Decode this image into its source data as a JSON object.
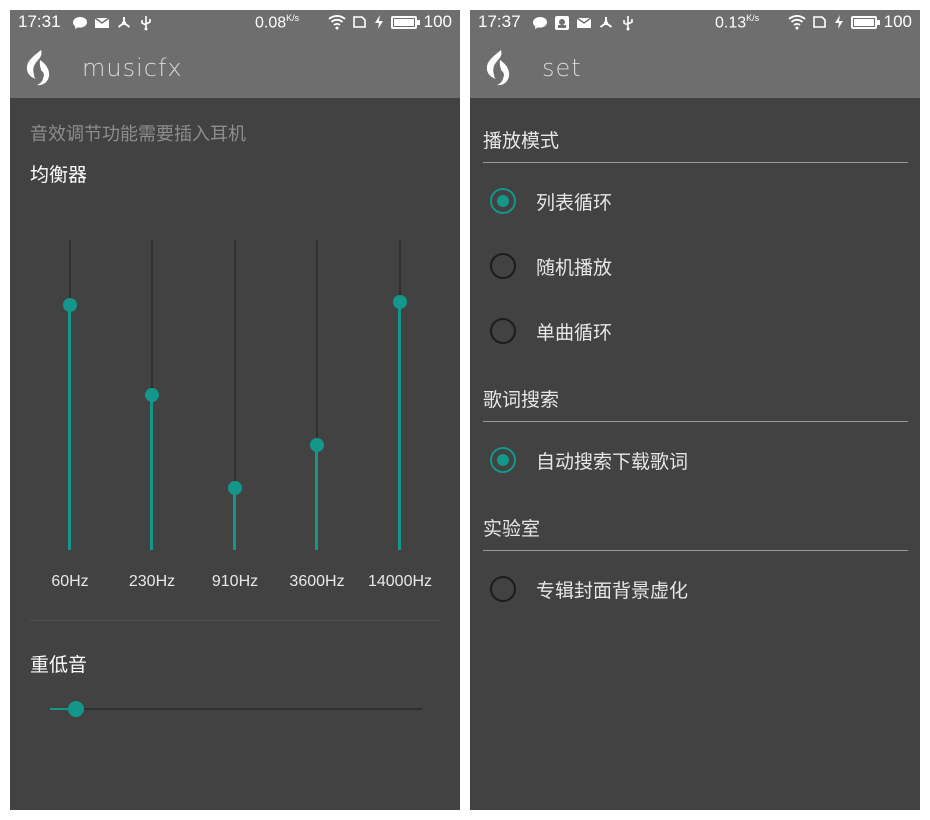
{
  "left": {
    "status": {
      "time": "17:31",
      "speed": "0.08",
      "speed_unit": "K/s",
      "battery": "100"
    },
    "app_title": "musicfx",
    "hint": "音效调节功能需要插入耳机",
    "equalizer_title": "均衡器",
    "bands": [
      {
        "label": "60Hz",
        "level": 0.79
      },
      {
        "label": "230Hz",
        "level": 0.5
      },
      {
        "label": "910Hz",
        "level": 0.2
      },
      {
        "label": "3600Hz",
        "level": 0.34
      },
      {
        "label": "14000Hz",
        "level": 0.8
      }
    ],
    "bass_title": "重低音",
    "bass_level": 0.07
  },
  "right": {
    "status": {
      "time": "17:37",
      "speed": "0.13",
      "speed_unit": "K/s",
      "battery": "100"
    },
    "app_title": "set",
    "play_mode_title": "播放模式",
    "play_modes": [
      {
        "label": "列表循环",
        "checked": true
      },
      {
        "label": "随机播放",
        "checked": false
      },
      {
        "label": "单曲循环",
        "checked": false
      }
    ],
    "lyrics_title": "歌词搜索",
    "lyrics_option": {
      "label": "自动搜索下载歌词",
      "checked": true
    },
    "lab_title": "实验室",
    "lab_option": {
      "label": "专辑封面背景虚化",
      "checked": false
    }
  },
  "colors": {
    "accent": "#12978a",
    "appbar": "#6e6e6e",
    "background": "#424242"
  },
  "icons": [
    "message-icon",
    "mail-icon",
    "share-icon",
    "usb-icon",
    "wifi-icon",
    "sim-icon",
    "charging-icon",
    "battery-icon",
    "flame-logo-icon"
  ]
}
